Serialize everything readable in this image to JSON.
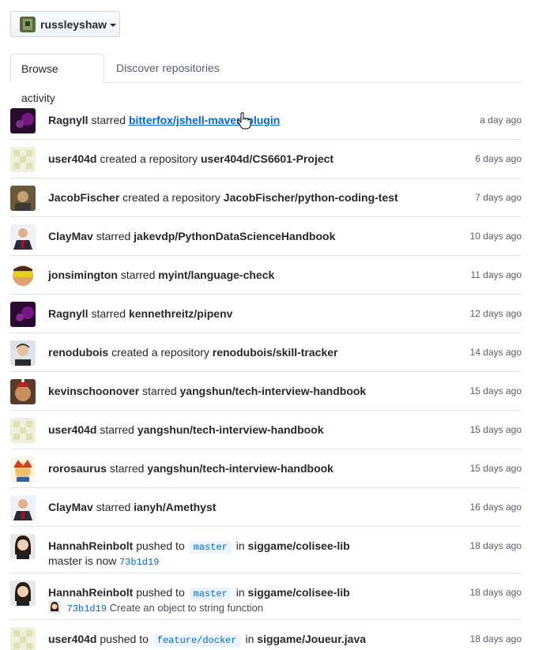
{
  "context": {
    "username": "russleyshaw"
  },
  "tabs": [
    {
      "label": "Browse activity",
      "active": true
    },
    {
      "label": "Discover repositories",
      "active": false
    }
  ],
  "feed": [
    {
      "user": "Ragnyll",
      "action": "starred",
      "target": "bitterfox/jshell-maven-plugin",
      "time": "a day ago",
      "avatar": "purple"
    },
    {
      "user": "user404d",
      "action": "created a repository",
      "target": "user404d/CS6601-Project",
      "time": "6 days ago",
      "avatar": "identicon"
    },
    {
      "user": "JacobFischer",
      "action": "created a repository",
      "target": "JacobFischer/python-coding-test",
      "time": "7 days ago",
      "avatar": "photo-brown"
    },
    {
      "user": "ClayMav",
      "action": "starred",
      "target": "jakevdp/PythonDataScienceHandbook",
      "time": "10 days ago",
      "avatar": "photo-suit"
    },
    {
      "user": "jonsimington",
      "action": "starred",
      "target": "myint/language-check",
      "time": "11 days ago",
      "avatar": "photo-yellow"
    },
    {
      "user": "Ragnyll",
      "action": "starred",
      "target": "kennethreitz/pipenv",
      "time": "12 days ago",
      "avatar": "purple"
    },
    {
      "user": "renodubois",
      "action": "created a repository",
      "target": "renodubois/skill-tracker",
      "time": "14 days ago",
      "avatar": "photo-face"
    },
    {
      "user": "kevinschoonover",
      "action": "starred",
      "target": "yangshun/tech-interview-handbook",
      "time": "15 days ago",
      "avatar": "photo-dog"
    },
    {
      "user": "user404d",
      "action": "starred",
      "target": "yangshun/tech-interview-handbook",
      "time": "15 days ago",
      "avatar": "identicon"
    },
    {
      "user": "rorosaurus",
      "action": "starred",
      "target": "yangshun/tech-interview-handbook",
      "time": "15 days ago",
      "avatar": "photo-cartoon"
    },
    {
      "user": "ClayMav",
      "action": "starred",
      "target": "ianyh/Amethyst",
      "time": "16 days ago",
      "avatar": "photo-suit"
    }
  ],
  "push_events": [
    {
      "user": "HannahReinbolt",
      "action": "pushed to",
      "branch": "master",
      "in": "in",
      "repo": "siggame/colisee-lib",
      "time": "18 days ago",
      "line2_prefix": "master is now",
      "sha": "73b1d19",
      "message": ""
    },
    {
      "user": "HannahReinbolt",
      "action": "pushed to",
      "branch": "master",
      "in": "in",
      "repo": "siggame/colisee-lib",
      "time": "18 days ago",
      "line2_prefix": "",
      "sha": "73b1d19",
      "message": "Create an object to string function"
    },
    {
      "user": "user404d",
      "action": "pushed to",
      "branch": "feature/docker",
      "in": "in",
      "repo": "siggame/Joueur.java",
      "time": "18 days ago"
    }
  ]
}
